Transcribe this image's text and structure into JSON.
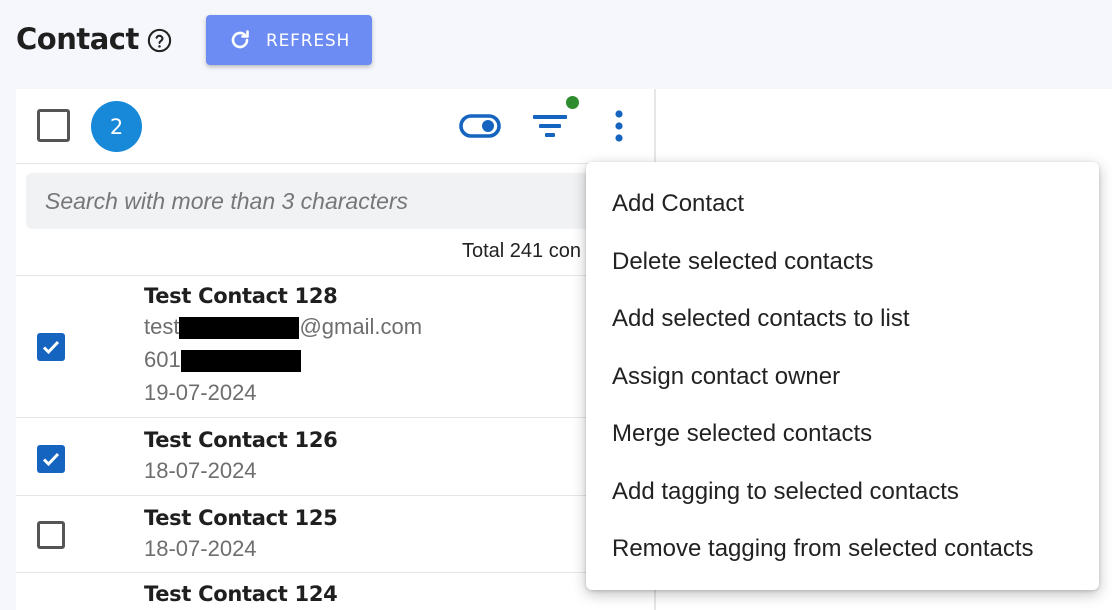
{
  "header": {
    "title": "Contact",
    "refresh_label": "REFRESH"
  },
  "toolbar": {
    "selected_count": "2"
  },
  "search": {
    "placeholder": "Search with more than 3 characters"
  },
  "summary": {
    "total_text": "Total 241 con"
  },
  "contacts": [
    {
      "name": "Test Contact 128",
      "email_prefix": "test",
      "email_suffix": "@gmail.com",
      "phone_prefix": "601",
      "date": "19-07-2024",
      "checked": true
    },
    {
      "name": "Test Contact 126",
      "date": "18-07-2024",
      "checked": true
    },
    {
      "name": "Test Contact 125",
      "date": "18-07-2024",
      "checked": false
    },
    {
      "name": "Test Contact 124"
    }
  ],
  "menu": {
    "items": [
      "Add Contact",
      "Delete selected contacts",
      "Add selected contacts to list",
      "Assign contact owner",
      "Merge selected contacts",
      "Add tagging to selected contacts",
      "Remove tagging from selected contacts"
    ]
  },
  "colors": {
    "accent": "#1888d8",
    "refresh_button": "#6d8cf3",
    "checkbox_checked": "#1565c0",
    "filter_active_dot": "#2e8b2e"
  },
  "icons": [
    "help-icon",
    "refresh-icon",
    "toggle-icon",
    "filter-icon",
    "more-vert-icon",
    "check-icon"
  ]
}
